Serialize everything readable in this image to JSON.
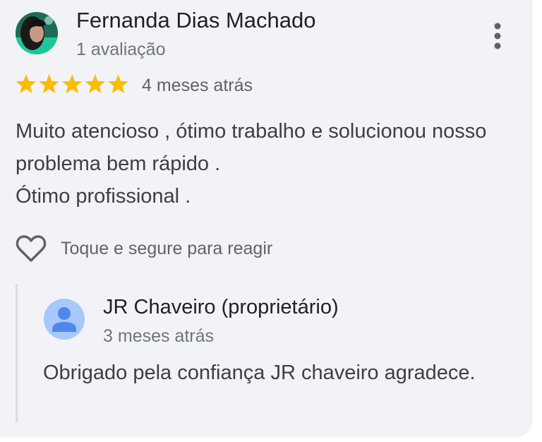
{
  "review": {
    "author_name": "Fernanda Dias Machado",
    "author_meta": "1 avaliação",
    "rating": 5,
    "rating_max": 5,
    "time": "4 meses atrás",
    "text": "Muito atencioso , ótimo trabalho e solucionou nosso problema bem rápido .\nÓtimo profissional .",
    "react_hint": "Toque e segure para reagir",
    "more_icon": "more-vert-icon",
    "star_color": "#fbbc04"
  },
  "owner_reply": {
    "owner_name": "JR Chaveiro (proprietário)",
    "time": "3 meses atrás",
    "text": "Obrigado pela confiança JR chaveiro agradece.",
    "avatar_icon": "person-icon",
    "avatar_bg": "#a8c7fa",
    "avatar_fg": "#4f86ec"
  }
}
